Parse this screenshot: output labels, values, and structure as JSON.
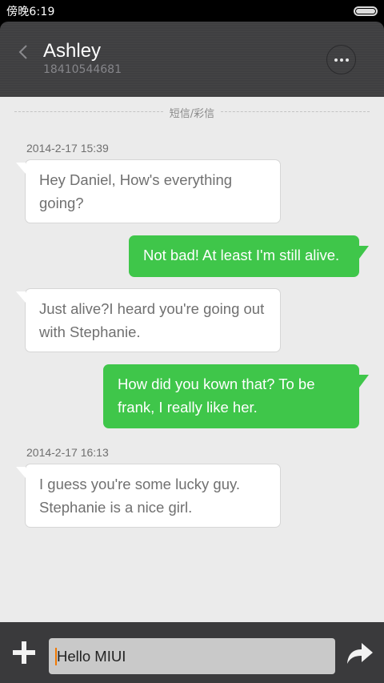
{
  "status_bar": {
    "time": "傍晚6:19"
  },
  "header": {
    "contact_name": "Ashley",
    "contact_number": "18410544681",
    "back_icon": "chevron-left-icon",
    "more_icon": "more-dots-icon"
  },
  "conversation": {
    "channel_label": "短信/彩信",
    "timestamps": [
      "2014-2-17 15:39",
      "2014-2-17 16:13"
    ],
    "messages": [
      {
        "direction": "incoming",
        "text": "Hey Daniel, How's everything going?"
      },
      {
        "direction": "outgoing",
        "text": "Not bad! At least I'm still alive."
      },
      {
        "direction": "incoming",
        "text": "Just  alive?I heard you're going out with Stephanie."
      },
      {
        "direction": "outgoing",
        "text": "How did you kown that? To be frank, I really like her."
      },
      {
        "direction": "incoming",
        "text": "I guess you're some lucky guy. Stephanie is a nice girl."
      }
    ]
  },
  "composer": {
    "input_value": "Hello MIUI",
    "add_icon": "plus-icon",
    "send_icon": "send-arrow-icon"
  },
  "colors": {
    "outgoing_bubble": "#3fc64a",
    "incoming_bubble": "#ffffff",
    "header_bg": "#3f3f41",
    "input_bar_bg": "#3a3a3c",
    "caret": "#f07800"
  }
}
